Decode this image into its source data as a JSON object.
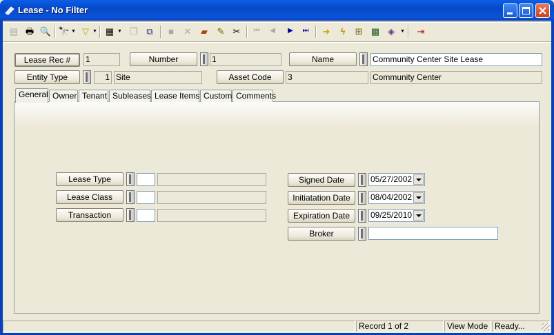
{
  "window": {
    "title": "Lease - No Filter"
  },
  "toolbar": {
    "buttons": [
      {
        "name": "new-record",
        "icon": "▤"
      },
      {
        "name": "print",
        "icon": "🖶"
      },
      {
        "name": "print-preview",
        "icon": "🔍"
      },
      {
        "name": "search",
        "icon": "🔭"
      },
      {
        "name": "filter",
        "icon": "▽"
      },
      {
        "name": "report",
        "icon": "▦"
      },
      {
        "name": "copy-record",
        "icon": "❐"
      },
      {
        "name": "duplicate",
        "icon": "⧉"
      },
      {
        "name": "save",
        "icon": "■"
      },
      {
        "name": "delete",
        "icon": "✕"
      },
      {
        "name": "books",
        "icon": "▰"
      },
      {
        "name": "edit-pencil",
        "icon": "✎"
      },
      {
        "name": "cut",
        "icon": "✂"
      },
      {
        "name": "first-record",
        "icon": "⏮"
      },
      {
        "name": "previous-record",
        "icon": "◀"
      },
      {
        "name": "next-record",
        "icon": "▶"
      },
      {
        "name": "last-record",
        "icon": "⏭"
      },
      {
        "name": "goto",
        "icon": "➜"
      },
      {
        "name": "lightning",
        "icon": "ϟ"
      },
      {
        "name": "tree",
        "icon": "⊞"
      },
      {
        "name": "calculator",
        "icon": "▩"
      },
      {
        "name": "book-menu",
        "icon": "◈"
      },
      {
        "name": "exit",
        "icon": "⇥"
      }
    ]
  },
  "header": {
    "lease_rec_label": "Lease Rec #",
    "lease_rec_value": "1",
    "number_label": "Number",
    "number_value": "1",
    "name_label": "Name",
    "name_value": "Community Center Site Lease",
    "entity_type_label": "Entity Type",
    "entity_type_code": "1",
    "entity_type_value": "Site",
    "asset_code_label": "Asset Code",
    "asset_code_value": "3",
    "asset_code_desc": "Community Center"
  },
  "tabs": [
    "General",
    "Owner",
    "Tenant",
    "Subleases",
    "Lease Items",
    "Custom",
    "Comments"
  ],
  "general": {
    "lease_type_label": "Lease Type",
    "lease_class_label": "Lease Class",
    "transaction_label": "Transaction",
    "signed_date_label": "Signed Date",
    "signed_date_value": "05/27/2002",
    "initiation_date_label": "Initiatation Date",
    "initiation_date_value": "08/04/2002",
    "expiration_date_label": "Expiration Date",
    "expiration_date_value": "09/25/2010",
    "broker_label": "Broker",
    "broker_value": ""
  },
  "status": {
    "record": "Record 1 of 2",
    "mode": "View Mode",
    "state": "Ready..."
  },
  "colors": {
    "titlebar": "#0a5ee8",
    "face": "#ece9d8"
  }
}
